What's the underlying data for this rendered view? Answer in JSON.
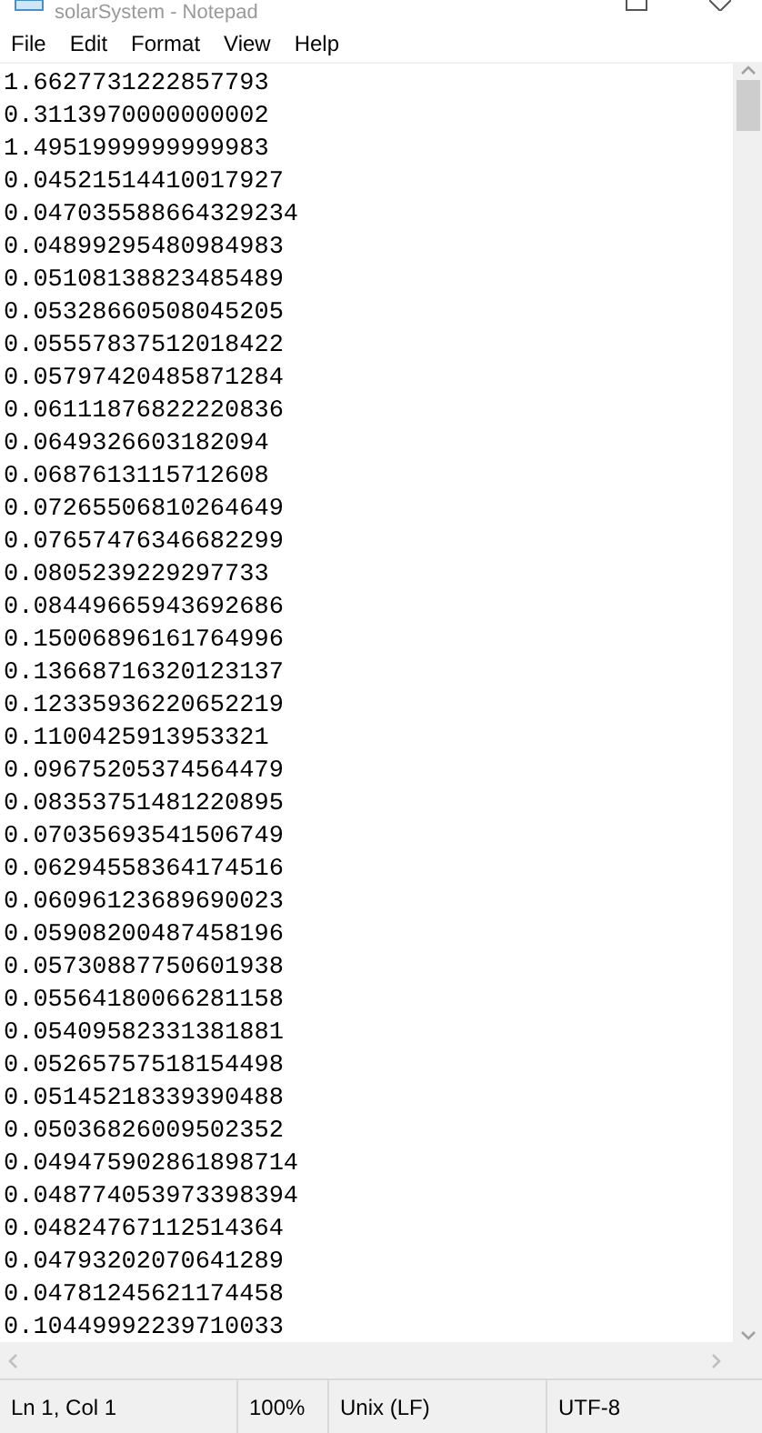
{
  "window": {
    "title": "solarSystem - Notepad"
  },
  "menu": [
    "File",
    "Edit",
    "Format",
    "View",
    "Help"
  ],
  "lines": [
    "1.6627731222857793",
    "0.3113970000000002",
    "1.4951999999999983",
    "0.04521514410017927",
    "0.047035588664329234",
    "0.04899295480984983",
    "0.05108138823485489",
    "0.05328660508045205",
    "0.05557837512018422",
    "0.05797420485871284",
    "0.06111876822220836",
    "0.0649326603182094",
    "0.0687613115712608",
    "0.07265506810264649",
    "0.07657476346682299",
    "0.0805239229297733",
    "0.08449665943692686",
    "0.15006896161764996",
    "0.13668716320123137",
    "0.12335936220652219",
    "0.1100425913953321",
    "0.09675205374564479",
    "0.08353751481220895",
    "0.07035693541506749",
    "0.06294558364174516",
    "0.06096123689690023",
    "0.05908200487458196",
    "0.05730887750601938",
    "0.05564180066281158",
    "0.05409582331381881",
    "0.05265757518154498",
    "0.05145218339390488",
    "0.05036826009502352",
    "0.049475902861898714",
    "0.048774053973398394",
    "0.04824767112514364",
    "0.04793202070641289",
    "0.04781245621174458",
    "0.10449992239710033"
  ],
  "status_bar": [
    "Ln 1, Col 1",
    "100%",
    "Unix (LF)",
    "UTF-8"
  ]
}
